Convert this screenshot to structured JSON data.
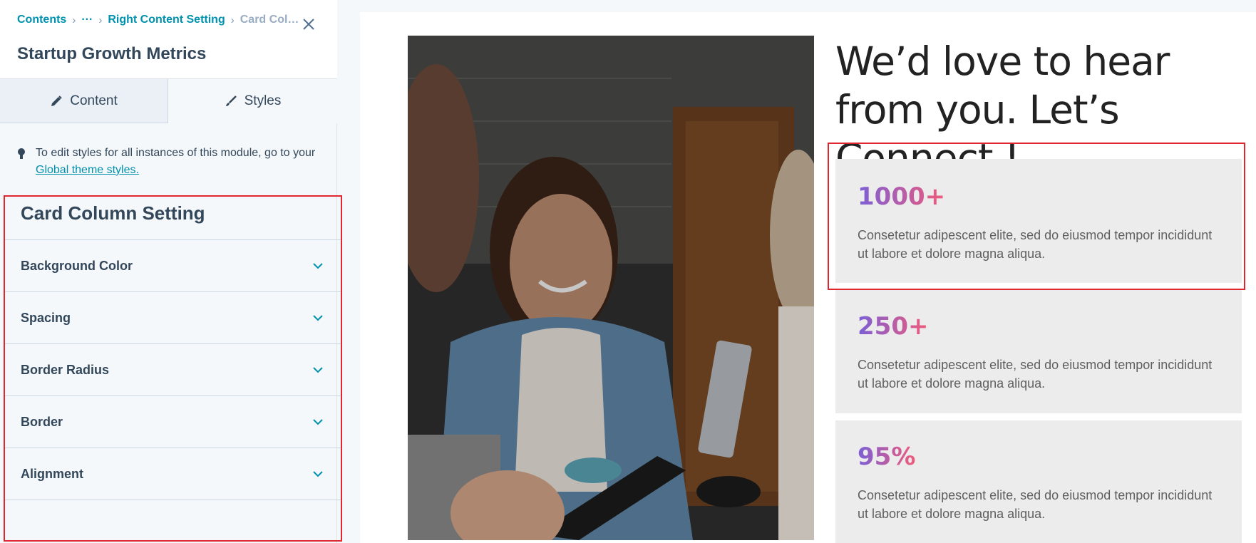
{
  "sidebar": {
    "breadcrumb": [
      "Contents",
      "···",
      "Right Content Setting",
      "Card Col…"
    ],
    "close_icon": "close-icon",
    "title": "Startup Growth Metrics",
    "tabs": [
      {
        "label": "Content",
        "icon": "pencil-icon"
      },
      {
        "label": "Styles",
        "icon": "brush-icon"
      }
    ],
    "notice": {
      "text": "To edit styles for all instances of this module, go to your",
      "link": "Global theme styles."
    },
    "card_settings": {
      "title": "Card Column Setting",
      "items": [
        "Background Color",
        "Spacing",
        "Border Radius",
        "Border",
        "Alignment"
      ]
    }
  },
  "preview": {
    "heading": "We’d love to hear from you. Let’s Connect !",
    "stats": [
      {
        "value": "1000+",
        "desc": "Consetetur adipescent elite, sed do eiusmod tempor incididunt ut labore et dolore magna aliqua."
      },
      {
        "value": "250+",
        "desc": "Consetetur adipescent elite, sed do eiusmod tempor incididunt ut labore et dolore magna aliqua."
      },
      {
        "value": "95%",
        "desc": "Consetetur adipescent elite, sed do eiusmod tempor incididunt ut labore et dolore magna aliqua."
      }
    ]
  },
  "colors": {
    "accent": "#0091ae",
    "highlight": "#e0262e",
    "gradient_start": "#7b5fd6",
    "gradient_end": "#f05b7a"
  }
}
